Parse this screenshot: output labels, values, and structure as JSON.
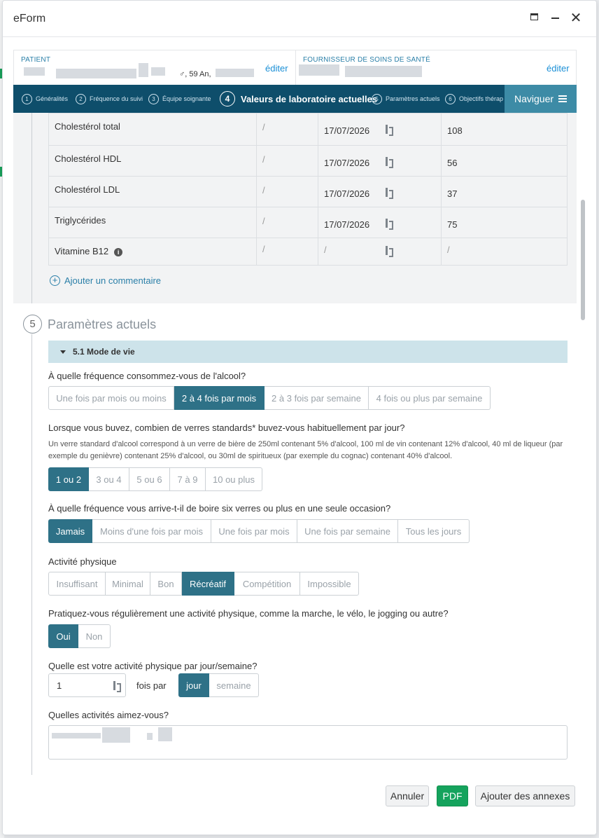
{
  "window": {
    "title": "eForm"
  },
  "patient": {
    "label": "PATIENT",
    "info": "♂, 59 An,",
    "edit_label": "éditer"
  },
  "provider": {
    "label": "FOURNISSEUR DE SOINS DE SANTÉ",
    "edit_label": "éditer"
  },
  "nav": {
    "steps": [
      {
        "num": "1",
        "label": "Généralités"
      },
      {
        "num": "2",
        "label": "Fréquence du suivi"
      },
      {
        "num": "3",
        "label": "Équipe soignante"
      },
      {
        "num": "4",
        "label": "Valeurs de laboratoire actuelles"
      },
      {
        "num": "5",
        "label": "Paramètres actuels"
      },
      {
        "num": "6",
        "label": "Objectifs thérap"
      }
    ],
    "navigate_label": "Naviguer"
  },
  "lab": {
    "rows": [
      {
        "name": "Cholestérol total",
        "unit": "/",
        "date": "17/07/2026",
        "value": "108"
      },
      {
        "name": "Cholestérol HDL",
        "unit": "/",
        "date": "17/07/2026",
        "value": "56"
      },
      {
        "name": "Cholestérol LDL",
        "unit": "/",
        "date": "17/07/2026",
        "value": "37"
      },
      {
        "name": "Triglycérides",
        "unit": "/",
        "date": "17/07/2026",
        "value": "75"
      },
      {
        "name": "Vitamine B12",
        "unit": "/",
        "date": "/",
        "value": "/"
      }
    ],
    "add_comment_label": "Ajouter un commentaire"
  },
  "section5": {
    "num": "5",
    "title": "Paramètres actuels",
    "subsection_title": "5.1 Mode de vie",
    "q1": {
      "label": "À quelle fréquence consommez-vous de l'alcool?",
      "options": [
        "Une fois par mois ou moins",
        "2 à 4 fois par mois",
        "2 à 3 fois par semaine",
        "4 fois ou plus par semaine"
      ]
    },
    "q2": {
      "label": "Lorsque vous buvez, combien de verres standards* buvez-vous habituellement par jour?",
      "note": "Un verre standard d'alcool correspond à un verre de bière de 250ml contenant 5% d'alcool, 100 ml de vin contenant 12% d'alcool, 40 ml de liqueur (par exemple du genièvre) contenant 25% d'alcool, ou 30ml de spiritueux (par exemple du cognac) contenant 40% d'alcool.",
      "options": [
        "1 ou 2",
        "3 ou 4",
        "5 ou 6",
        "7 à 9",
        "10 ou plus"
      ]
    },
    "q3": {
      "label": "À quelle fréquence vous arrive-t-il de boire six verres ou plus en une seule occasion?",
      "options": [
        "Jamais",
        "Moins d'une fois par mois",
        "Une fois par mois",
        "Une fois par semaine",
        "Tous les jours"
      ]
    },
    "q4": {
      "label": "Activité physique",
      "options": [
        "Insuffisant",
        "Minimal",
        "Bon",
        "Récréatif",
        "Compétition",
        "Impossible"
      ]
    },
    "q5": {
      "label": "Pratiquez-vous régulièrement une activité physique, comme la marche, le vélo, le jogging ou autre?",
      "options": [
        "Oui",
        "Non"
      ]
    },
    "q6": {
      "label": "Quelle est votre activité physique par jour/semaine?",
      "value": "1",
      "fois_label": "fois par",
      "options": [
        "jour",
        "semaine"
      ]
    },
    "q7": {
      "label": "Quelles activités aimez-vous?"
    }
  },
  "footer": {
    "cancel_label": "Annuler",
    "pdf_label": "PDF",
    "annex_label": "Ajouter des annexes"
  },
  "colors": {
    "nav_bg": "#0e4e6b",
    "navigate_bg": "#3d8ba6",
    "selected": "#2e7187",
    "pdf": "#15a35d",
    "link": "#1a8fd6"
  }
}
